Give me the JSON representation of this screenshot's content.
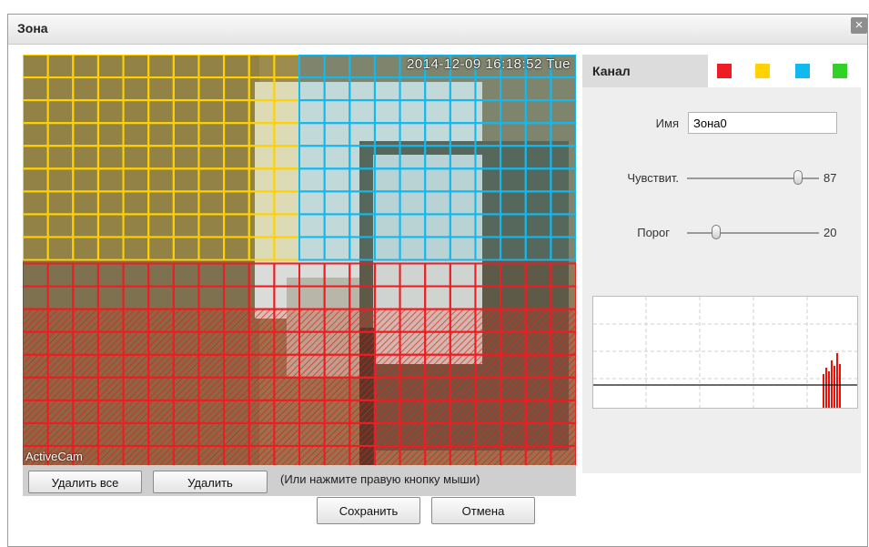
{
  "dialog": {
    "title": "Зона"
  },
  "video": {
    "timestamp": "2014-12-09 16:18:52 Tue",
    "brand": "ActiveCam"
  },
  "actions": {
    "delete_all": "Удалить все",
    "delete": "Удалить",
    "hint": "(Или нажмите правую кнопку мыши)"
  },
  "panel": {
    "channel_label": "Канал",
    "channel_colors": [
      "#ee1d23",
      "#ffd200",
      "#11b9ef",
      "#31d128"
    ],
    "name_label": "Имя",
    "name_value": "Зона0",
    "sensitivity_label": "Чувствит.",
    "sensitivity_value": "87",
    "threshold_label": "Порог",
    "threshold_value": "20"
  },
  "footer": {
    "save": "Сохранить",
    "cancel": "Отмена"
  },
  "zone_colors": {
    "yellow": "#ffd200",
    "cyan": "#11b9ef",
    "red": "#ee1d23"
  }
}
